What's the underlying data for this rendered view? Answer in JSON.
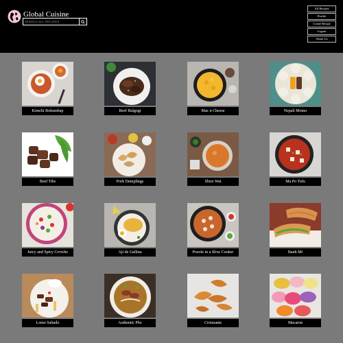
{
  "header": {
    "brand": "Global Cuisine",
    "logo_icon": "globe-icon",
    "search": {
      "placeholder": "SEARCH ALL RECIPES",
      "value": ""
    }
  },
  "nav": {
    "items": [
      {
        "label": "All Recipes"
      },
      {
        "label": "Profile"
      },
      {
        "label": "Create Recipe"
      },
      {
        "label": "Logout"
      },
      {
        "label": "About Us"
      }
    ]
  },
  "recipes": [
    {
      "name": "Kimchi Bokumbap"
    },
    {
      "name": "Beef Bulgogi"
    },
    {
      "name": "Mac n Cheese"
    },
    {
      "name": "Nepali Momo"
    },
    {
      "name": "Beef Tibs"
    },
    {
      "name": "Pork Dumplings"
    },
    {
      "name": "Shiro Wat"
    },
    {
      "name": "Ma Po Tofu"
    },
    {
      "name": "Juicy and Spicy Ceviche"
    },
    {
      "name": "Aji de Gallina"
    },
    {
      "name": "Pozole in a Slow Cooker"
    },
    {
      "name": "Banh Mi"
    },
    {
      "name": "Lomo Saltado"
    },
    {
      "name": "Authentic Pho"
    },
    {
      "name": "Croissants"
    },
    {
      "name": "Macaron"
    }
  ],
  "colors": {
    "header_bg": "#000000",
    "page_bg": "#7a7a7a",
    "label_bg": "#000000"
  }
}
